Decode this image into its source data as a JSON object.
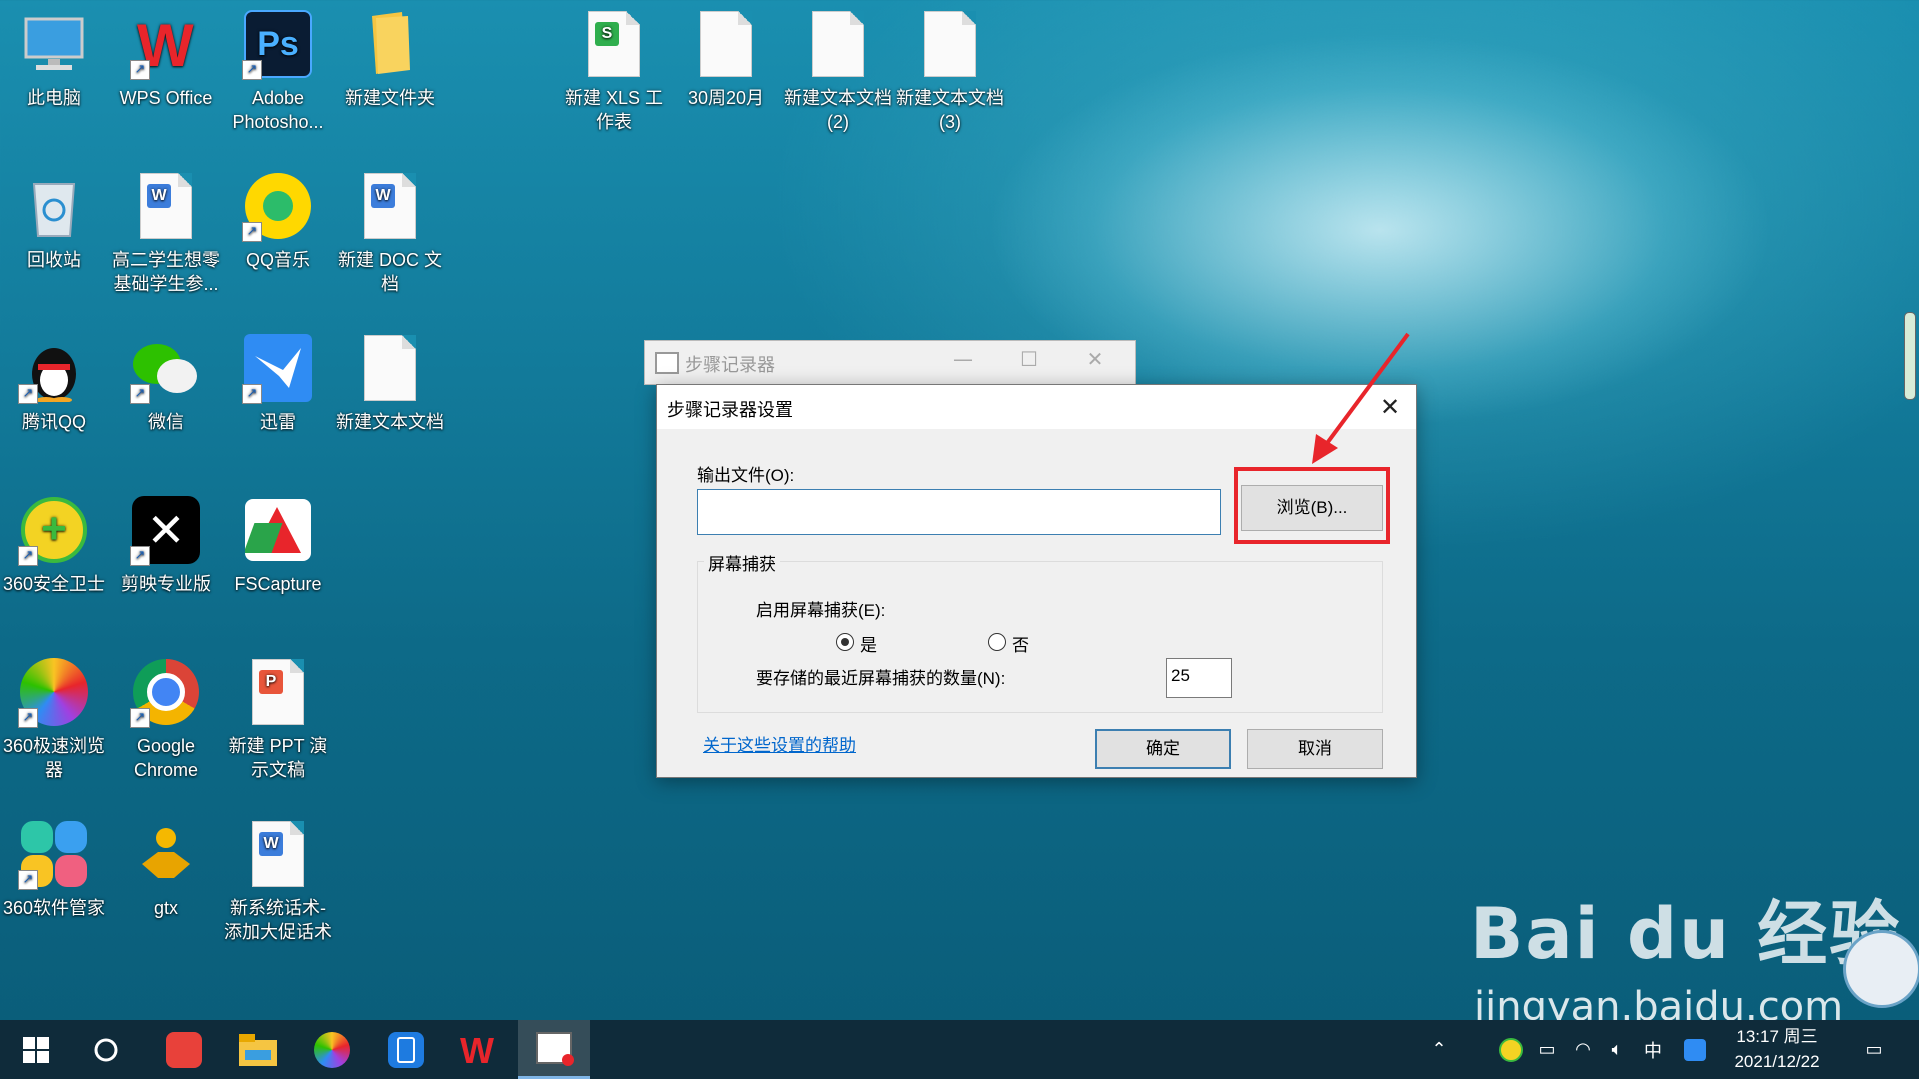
{
  "desktop": {
    "icons": [
      {
        "label": "此电脑"
      },
      {
        "label": "WPS Office"
      },
      {
        "label": "Adobe Photosho..."
      },
      {
        "label": "新建文件夹"
      },
      {
        "label": "新建 XLS 工作表"
      },
      {
        "label": "30周20月"
      },
      {
        "label": "新建文本文档 (2)"
      },
      {
        "label": "新建文本文档 (3)"
      },
      {
        "label": "回收站"
      },
      {
        "label": "高二学生想零基础学生参..."
      },
      {
        "label": "QQ音乐"
      },
      {
        "label": "新建 DOC 文档"
      },
      {
        "label": "腾讯QQ"
      },
      {
        "label": "微信"
      },
      {
        "label": "迅雷"
      },
      {
        "label": "新建文本文档"
      },
      {
        "label": "360安全卫士"
      },
      {
        "label": "剪映专业版"
      },
      {
        "label": "FSCapture"
      },
      {
        "label": "360极速浏览器"
      },
      {
        "label": "Google Chrome"
      },
      {
        "label": "新建 PPT 演示文稿"
      },
      {
        "label": "360软件管家"
      },
      {
        "label": "gtx"
      },
      {
        "label": "新系统话术-添加大促话术"
      }
    ]
  },
  "back_window": {
    "title": "步骤记录器",
    "minimize": "—",
    "maximize": "☐",
    "close": "✕"
  },
  "dialog": {
    "title": "步骤记录器设置",
    "close": "✕",
    "output_label": "输出文件(O):",
    "output_value": "",
    "browse_label": "浏览(B)...",
    "group_title": "屏幕捕获",
    "enable_label": "启用屏幕捕获(E):",
    "yes_label": "是",
    "no_label": "否",
    "count_label": "要存储的最近屏幕捕获的数量(N):",
    "count_value": "25",
    "help_link": "关于这些设置的帮助",
    "ok_label": "确定",
    "cancel_label": "取消",
    "enable_selected": "是"
  },
  "annotation": {
    "color": "#e8252b"
  },
  "watermark": {
    "main": "Bai du 经验",
    "sub": "jingyan.baidu.com"
  },
  "taskbar": {
    "ime": "中",
    "time": "13:17 周三",
    "date": "2021/12/22",
    "items": [
      "start-icon",
      "search-icon",
      "app-red-icon",
      "file-explorer-icon",
      "browser-360-icon",
      "tablet-icon",
      "wps-icon",
      "steps-recorder-icon"
    ]
  }
}
